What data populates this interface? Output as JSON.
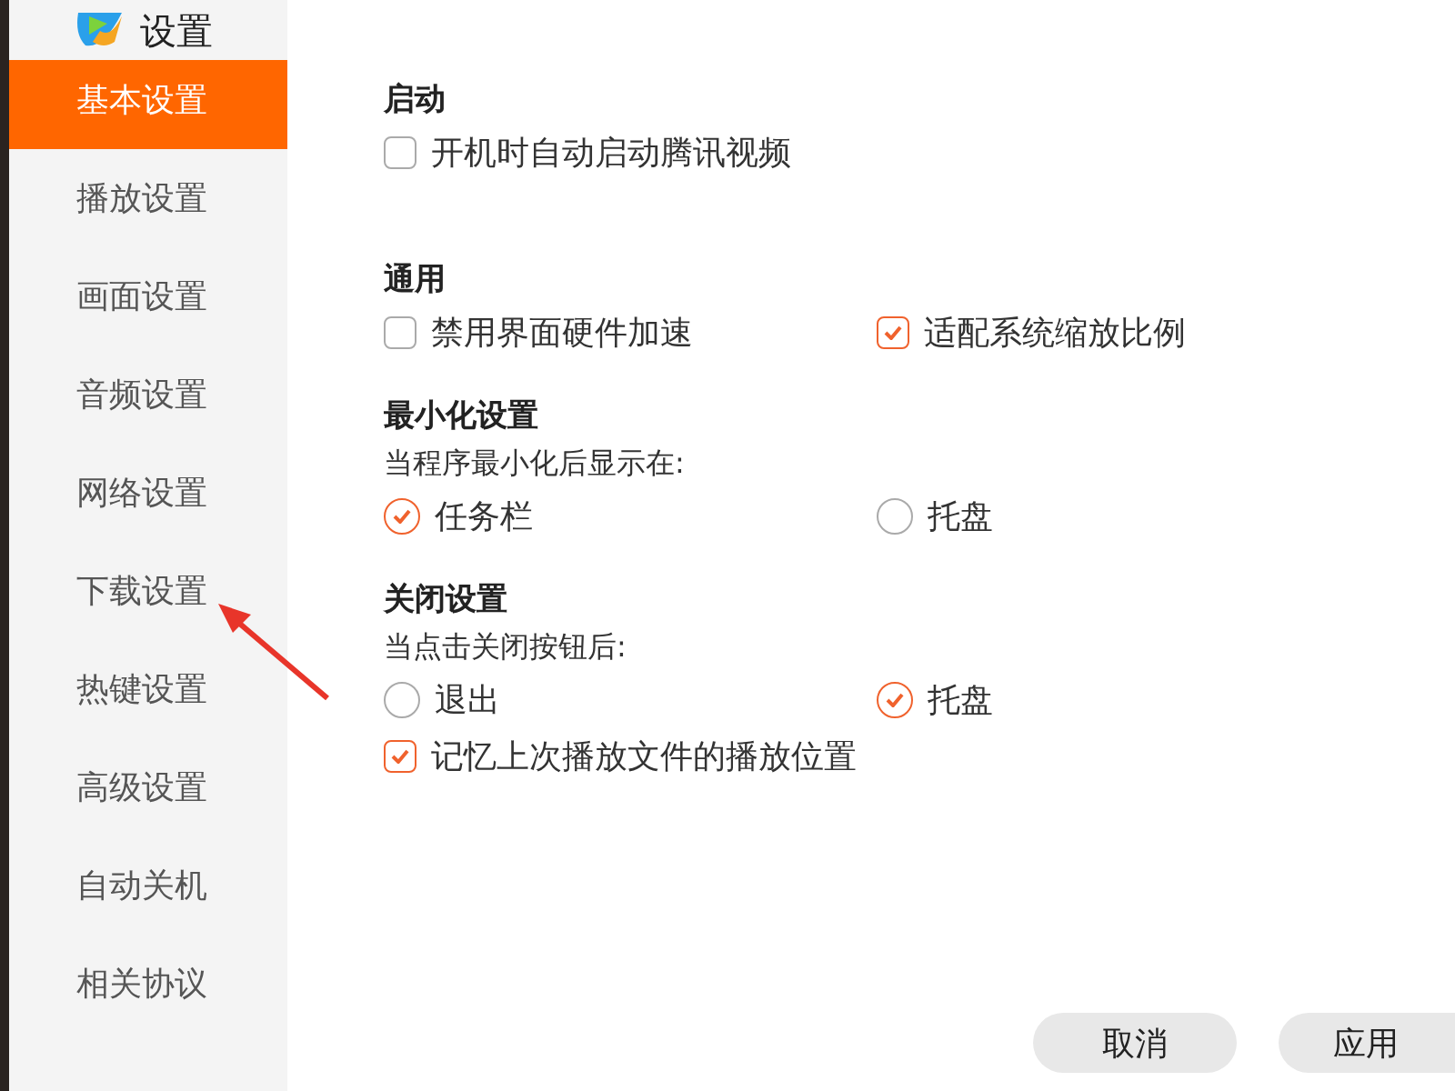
{
  "window": {
    "title": "设置"
  },
  "sidebar": {
    "items": [
      {
        "label": "基本设置",
        "selected": true
      },
      {
        "label": "播放设置",
        "selected": false
      },
      {
        "label": "画面设置",
        "selected": false
      },
      {
        "label": "音频设置",
        "selected": false
      },
      {
        "label": "网络设置",
        "selected": false
      },
      {
        "label": "下载设置",
        "selected": false
      },
      {
        "label": "热键设置",
        "selected": false
      },
      {
        "label": "高级设置",
        "selected": false
      },
      {
        "label": "自动关机",
        "selected": false
      },
      {
        "label": "相关协议",
        "selected": false
      }
    ]
  },
  "sections": [
    {
      "title": "启动",
      "rows": [
        {
          "kind": "options",
          "options": [
            {
              "kind": "checkbox",
              "label": "开机时自动启动腾讯视频",
              "checked": false
            }
          ]
        }
      ]
    },
    {
      "title": "通用",
      "rows": [
        {
          "kind": "options",
          "options": [
            {
              "kind": "checkbox",
              "label": "禁用界面硬件加速",
              "checked": false
            },
            {
              "kind": "checkbox",
              "label": "适配系统缩放比例",
              "checked": true
            }
          ]
        }
      ]
    },
    {
      "title": "最小化设置",
      "rows": [
        {
          "kind": "text",
          "text": "当程序最小化后显示在:"
        },
        {
          "kind": "options",
          "options": [
            {
              "kind": "radio",
              "label": "任务栏",
              "checked": true
            },
            {
              "kind": "radio",
              "label": "托盘",
              "checked": false
            }
          ]
        }
      ]
    },
    {
      "title": "关闭设置",
      "rows": [
        {
          "kind": "text",
          "text": "当点击关闭按钮后:"
        },
        {
          "kind": "options",
          "options": [
            {
              "kind": "radio",
              "label": "退出",
              "checked": false
            },
            {
              "kind": "radio",
              "label": "托盘",
              "checked": true
            }
          ]
        },
        {
          "kind": "options",
          "options": [
            {
              "kind": "checkbox",
              "label": "记忆上次播放文件的播放位置",
              "checked": true
            }
          ]
        }
      ]
    }
  ],
  "buttons": [
    "取消",
    "应用"
  ]
}
